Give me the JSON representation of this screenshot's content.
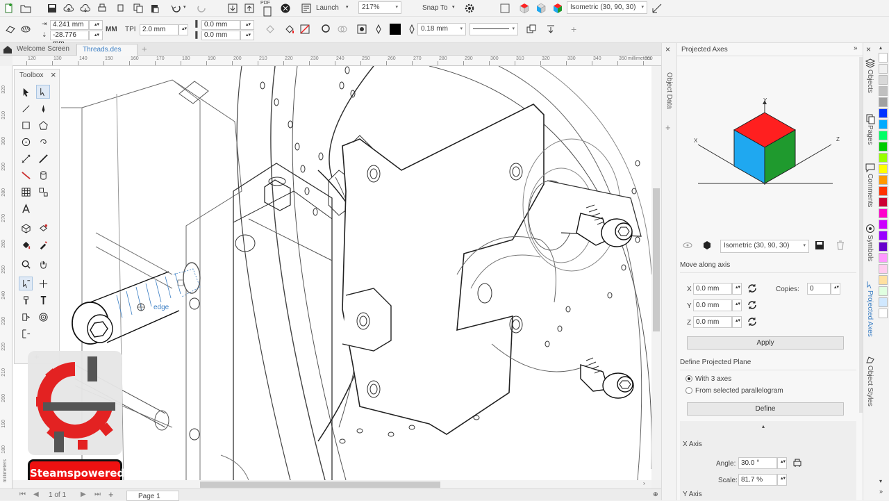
{
  "toolbar": {
    "launch_label": "Launch",
    "zoom_value": "217%",
    "snap_label": "Snap To",
    "view_preset": "Isometric (30, 90, 30)",
    "pdf_label": "PDF"
  },
  "property_bar": {
    "width_value": "4.241 mm",
    "height_value": "-28.776 mm",
    "unit_label": "MM",
    "tpi_label": "TPI",
    "tpi_value": "2.0 mm",
    "offset_x": "0.0 mm",
    "offset_y": "0.0 mm",
    "outline_width": "0.18 mm"
  },
  "tabs": [
    {
      "label": "Welcome Screen"
    },
    {
      "label": "Threads.des"
    }
  ],
  "ruler": {
    "h_ticks": [
      "120",
      "130",
      "140",
      "150",
      "160",
      "170",
      "180",
      "190",
      "200",
      "210",
      "220",
      "230",
      "240",
      "250",
      "260",
      "270",
      "280",
      "290",
      "300",
      "310",
      "320",
      "330",
      "340",
      "350",
      "360"
    ],
    "h_unit": "millimeters",
    "v_ticks": [
      "320",
      "310",
      "300",
      "290",
      "280",
      "270",
      "260",
      "250",
      "240",
      "230",
      "220",
      "210",
      "200",
      "190",
      "180"
    ],
    "v_unit": "millimeters"
  },
  "toolbox": {
    "title": "Toolbox"
  },
  "canvas": {
    "snap_hint": "edge"
  },
  "status": {
    "page_counter": "1 of 1",
    "page_tab": "Page 1"
  },
  "panel": {
    "title": "Projected Axes",
    "axis_labels": {
      "y": "Y",
      "x": "X",
      "z": "Z"
    },
    "preset": "Isometric (30, 90, 30)",
    "move_along_axis": "Move along axis",
    "x_label": "X",
    "x_value": "0.0 mm",
    "y_label": "Y",
    "y_value": "0.0 mm",
    "z_label": "Z",
    "z_value": "0.0 mm",
    "copies_label": "Copies:",
    "copies_value": "0",
    "apply_label": "Apply",
    "define_plane_label": "Define Projected Plane",
    "with_axes_label": "With 3 axes",
    "from_parallelogram_label": "From selected parallelogram",
    "define_label": "Define",
    "x_axis_label": "X Axis",
    "angle_label": "Angle:",
    "angle_value": "30.0 °",
    "scale_label": "Scale:",
    "scale_value": "81.7 %",
    "y_axis_label": "Y Axis"
  },
  "side_tabs": {
    "object_data": "Object Data",
    "objects": "Objects",
    "pages": "Pages",
    "comments": "Comments",
    "symbols": "Symbols",
    "projected_axes": "Projected Axes",
    "object_styles": "Object Styles"
  },
  "watermark": {
    "brand": "Steamspowered"
  },
  "colors": {
    "cube_top": "#ff1f1f",
    "cube_left": "#1fa8f0",
    "cube_right": "#1f9a2e",
    "accent": "#3c7fc4",
    "palette": [
      "#ffffff",
      "#f0f0f0",
      "#d8d8d8",
      "#c0c0c0",
      "#a0a0a0",
      "#0033ff",
      "#00aaff",
      "#00ff66",
      "#00cc00",
      "#99ff00",
      "#ffff00",
      "#ff9900",
      "#ff3300",
      "#cc0033",
      "#ff00cc",
      "#cc00ff",
      "#9900ff",
      "#6600cc",
      "#ff99ff",
      "#ffccee",
      "#ffe0a0",
      "#e0ffe0",
      "#d0e8ff",
      "#ffffff"
    ]
  }
}
